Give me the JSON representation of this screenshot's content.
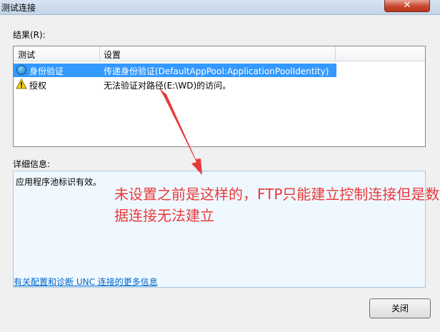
{
  "window": {
    "title": "测试连接",
    "close_glyph": "✕"
  },
  "results": {
    "label": "结果(R):",
    "columns": [
      "测试",
      "设置"
    ],
    "rows": [
      {
        "test": "身份验证",
        "setting": "传递身份验证(DefaultAppPool:ApplicationPoolIdentity)",
        "status": "ok"
      },
      {
        "test": "授权",
        "setting": "无法验证对路径(E:\\WD)的访问。",
        "status": "warning"
      }
    ]
  },
  "details": {
    "label": "详细信息:",
    "text": "应用程序池标识有效。"
  },
  "annotation": {
    "text": "未设置之前是这样的，FTP只能建立控制连接但是数据连接无法建立",
    "color": "#e83a3a"
  },
  "footer": {
    "link": "有关配置和诊断 UNC 连接的更多信息",
    "close_button": "关闭"
  }
}
